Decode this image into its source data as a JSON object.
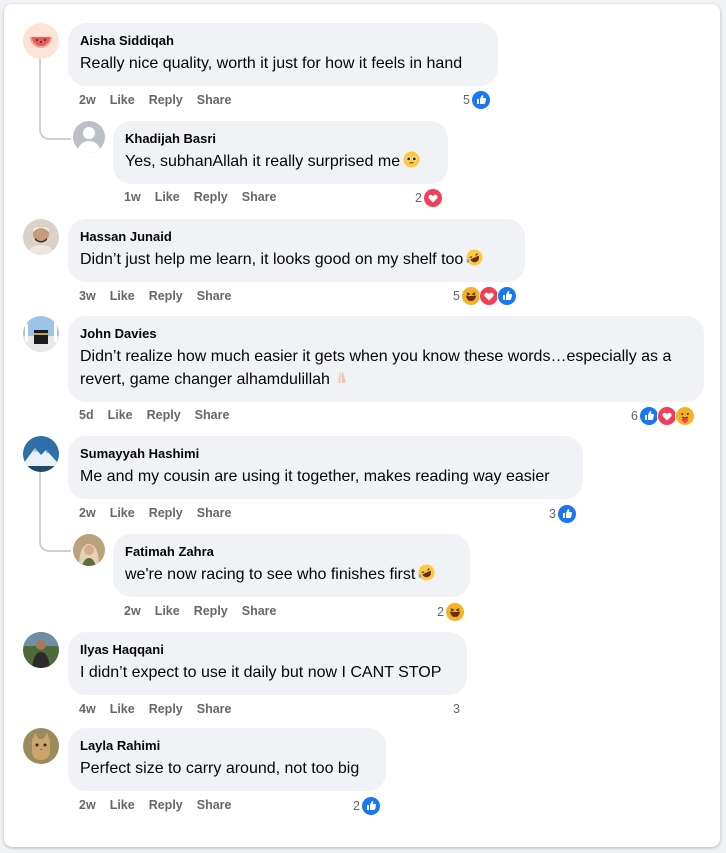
{
  "colors": {
    "like": "#1877f2",
    "love": "#f33e58",
    "haha": "#f7b125",
    "meta": "#65676b",
    "bubble": "#f0f2f5"
  },
  "actions": {
    "like": "Like",
    "reply": "Reply",
    "share": "Share"
  },
  "comments": [
    {
      "name": "Aisha Siddiqah",
      "text": "Really nice quality, worth it just for how it feels in hand",
      "time": "2w",
      "reactions_count": "5",
      "reactions": [
        "like-icon"
      ],
      "avatar": "watermelon-avatar"
    },
    {
      "name": "Khadijah Basri",
      "text": "Yes, subhanAllah it really surprised me",
      "emoji": "pleading-face-emoji",
      "time": "1w",
      "reactions_count": "2",
      "reactions": [
        "love-icon"
      ],
      "avatar": "default-avatar"
    },
    {
      "name": "Hassan Junaid",
      "text": "Didn’t just help me learn, it looks good on my shelf too",
      "emoji": "rofl-emoji",
      "time": "3w",
      "reactions_count": "5",
      "reactions": [
        "haha-icon",
        "love-icon",
        "like-icon"
      ],
      "avatar": "man-avatar"
    },
    {
      "name": "John Davies",
      "text": "Didn’t realize how much easier it gets when you know these words…especially as a revert, game changer alhamdulillah",
      "emoji": "praying-hands-emoji",
      "time": "5d",
      "reactions_count": "6",
      "reactions": [
        "like-icon",
        "love-icon",
        "care-icon"
      ],
      "avatar": "kaaba-avatar"
    },
    {
      "name": "Sumayyah Hashimi",
      "text": "Me and my cousin are using it together, makes reading way easier",
      "time": "2w",
      "reactions_count": "3",
      "reactions": [
        "like-icon"
      ],
      "avatar": "mountain-avatar"
    },
    {
      "name": "Fatimah Zahra",
      "text": "we're now racing to see who finishes first",
      "emoji": "rofl-emoji",
      "time": "2w",
      "reactions_count": "2",
      "reactions": [
        "haha-icon"
      ],
      "avatar": "woman-avatar"
    },
    {
      "name": "Ilyas Haqqani",
      "text": "I didn’t expect to use it daily but now I CANT STOP",
      "time": "4w",
      "reactions_count": "3",
      "reactions": [],
      "avatar": "man-outdoor-avatar"
    },
    {
      "name": "Layla Rahimi",
      "text": "Perfect size to carry around, not too big",
      "time": "2w",
      "reactions_count": "2",
      "reactions": [
        "like-icon"
      ],
      "avatar": "cat-avatar"
    }
  ]
}
